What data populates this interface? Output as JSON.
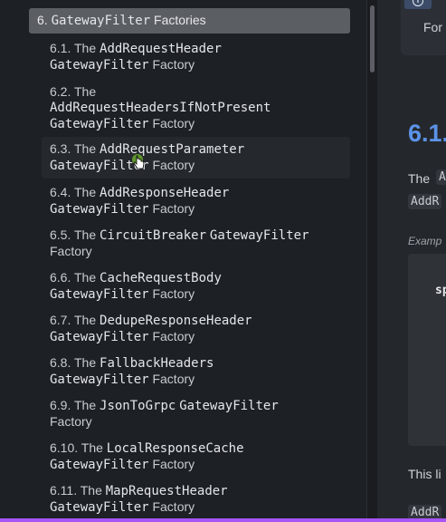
{
  "nav": {
    "section": {
      "num": "6.",
      "code": "GatewayFilter",
      "tail": "Factories"
    },
    "items": [
      {
        "num": "6.1. The",
        "code1": "AddRequestHeader",
        "code2": "GatewayFilter",
        "tail": "Factory"
      },
      {
        "num": "6.2. The",
        "code1": "AddRequestHeadersIfNotPresent",
        "code2": "GatewayFilter",
        "tail": "Factory"
      },
      {
        "num": "6.3. The",
        "code1": "AddRequestParameter",
        "code2": "GatewayFilter",
        "tail": "Factory"
      },
      {
        "num": "6.4. The",
        "code1": "AddResponseHeader",
        "code2": "GatewayFilter",
        "tail": "Factory"
      },
      {
        "num": "6.5. The",
        "code1": "CircuitBreaker",
        "code2": "GatewayFilter",
        "tail": "Factory"
      },
      {
        "num": "6.6. The",
        "code1": "CacheRequestBody",
        "code2": "GatewayFilter",
        "tail": "Factory"
      },
      {
        "num": "6.7. The",
        "code1": "DedupeResponseHeader",
        "code2": "GatewayFilter",
        "tail": "Factory"
      },
      {
        "num": "6.8. The",
        "code1": "FallbackHeaders",
        "code2": "GatewayFilter",
        "tail": "Factory"
      },
      {
        "num": "6.9. The",
        "code1": "JsonToGrpc",
        "code2": "GatewayFilter",
        "tail": "Factory"
      },
      {
        "num": "6.10. The",
        "code1": "LocalResponseCache",
        "code2": "GatewayFilter",
        "tail": "Factory"
      },
      {
        "num": "6.11. The",
        "code1": "MapRequestHeader",
        "code2": "GatewayFilter",
        "tail": "Factory"
      }
    ]
  },
  "content": {
    "tip_icon": "info-icon",
    "tip_text": "For",
    "heading": "6.1.",
    "para_start": "The",
    "chip_a": "A",
    "chip_b": "AddR",
    "example_label": "Examp",
    "code_fragment": "sp",
    "para2": "This li",
    "chip_c": "AddR"
  },
  "colors": {
    "background": "#1d2025",
    "highlight": "#5b5e63",
    "heading_accent": "#5b93e8",
    "bottom_bar": "#a855f7"
  }
}
